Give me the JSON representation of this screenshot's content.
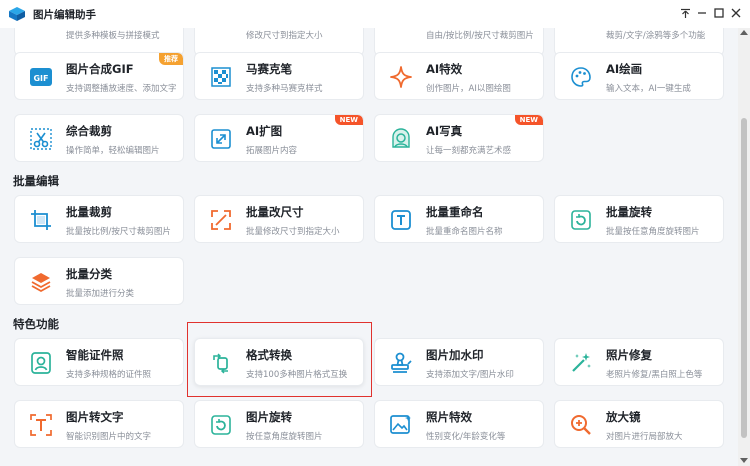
{
  "window": {
    "title": "图片编辑助手",
    "controls": {
      "pin": "⊤",
      "minimize": "—",
      "maximize": "☐",
      "close": "✕"
    }
  },
  "colors": {
    "accent": "#1c8fd1",
    "badge_orange": "#f5a130",
    "badge_red": "#f5542a",
    "highlight": "#e0322e"
  },
  "top_cut": [
    {
      "desc": "提供多种模板与拼接模式"
    },
    {
      "desc": "修改尺寸到指定大小"
    },
    {
      "desc": "自由/按比例/按尺寸裁剪图片"
    },
    {
      "desc": "裁剪/文字/涂鸦等多个功能"
    }
  ],
  "row1": [
    {
      "title": "图片合成GIF",
      "desc": "支持调整播放速度、添加文字",
      "icon": "gif-icon",
      "badge": "推荐"
    },
    {
      "title": "马赛克笔",
      "desc": "支持多种马赛克样式",
      "icon": "mosaic-icon"
    },
    {
      "title": "AI特效",
      "desc": "创作图片，AI以图绘图",
      "icon": "sparkle-icon"
    },
    {
      "title": "AI绘画",
      "desc": "输入文本，AI一键生成",
      "icon": "palette-icon"
    }
  ],
  "row2": [
    {
      "title": "综合裁剪",
      "desc": "操作简单，轻松编辑图片",
      "icon": "scissors-icon"
    },
    {
      "title": "AI扩图",
      "desc": "拓展图片内容",
      "icon": "expand-icon",
      "badge": "NEW"
    },
    {
      "title": "AI写真",
      "desc": "让每一刻都充满艺术感",
      "icon": "portrait-icon",
      "badge": "NEW"
    }
  ],
  "sections": {
    "batch": "批量编辑",
    "special": "特色功能"
  },
  "batch": [
    {
      "title": "批量裁剪",
      "desc": "批量按比例/按尺寸裁剪图片",
      "icon": "crop-icon"
    },
    {
      "title": "批量改尺寸",
      "desc": "批量修改尺寸到指定大小",
      "icon": "resize-icon"
    },
    {
      "title": "批量重命名",
      "desc": "批量重命名图片名称",
      "icon": "rename-icon"
    },
    {
      "title": "批量旋转",
      "desc": "批量按任意角度旋转图片",
      "icon": "rotate-icon"
    },
    {
      "title": "批量分类",
      "desc": "批量添加进行分类",
      "icon": "layers-icon"
    }
  ],
  "special": [
    {
      "title": "智能证件照",
      "desc": "支持多种规格的证件照",
      "icon": "id-photo-icon"
    },
    {
      "title": "格式转换",
      "desc": "支持100多种图片格式互换",
      "icon": "convert-icon"
    },
    {
      "title": "图片加水印",
      "desc": "支持添加文字/图片水印",
      "icon": "stamp-icon"
    },
    {
      "title": "照片修复",
      "desc": "老照片修复/黑白照上色等",
      "icon": "magic-wand-icon"
    },
    {
      "title": "图片转文字",
      "desc": "智能识别图片中的文字",
      "icon": "ocr-text-icon"
    },
    {
      "title": "图片旋转",
      "desc": "按任意角度旋转图片",
      "icon": "image-rotate-icon"
    },
    {
      "title": "照片特效",
      "desc": "性别变化/年龄变化等",
      "icon": "image-effect-icon"
    },
    {
      "title": "放大镜",
      "desc": "对图片进行局部放大",
      "icon": "magnifier-icon"
    }
  ]
}
